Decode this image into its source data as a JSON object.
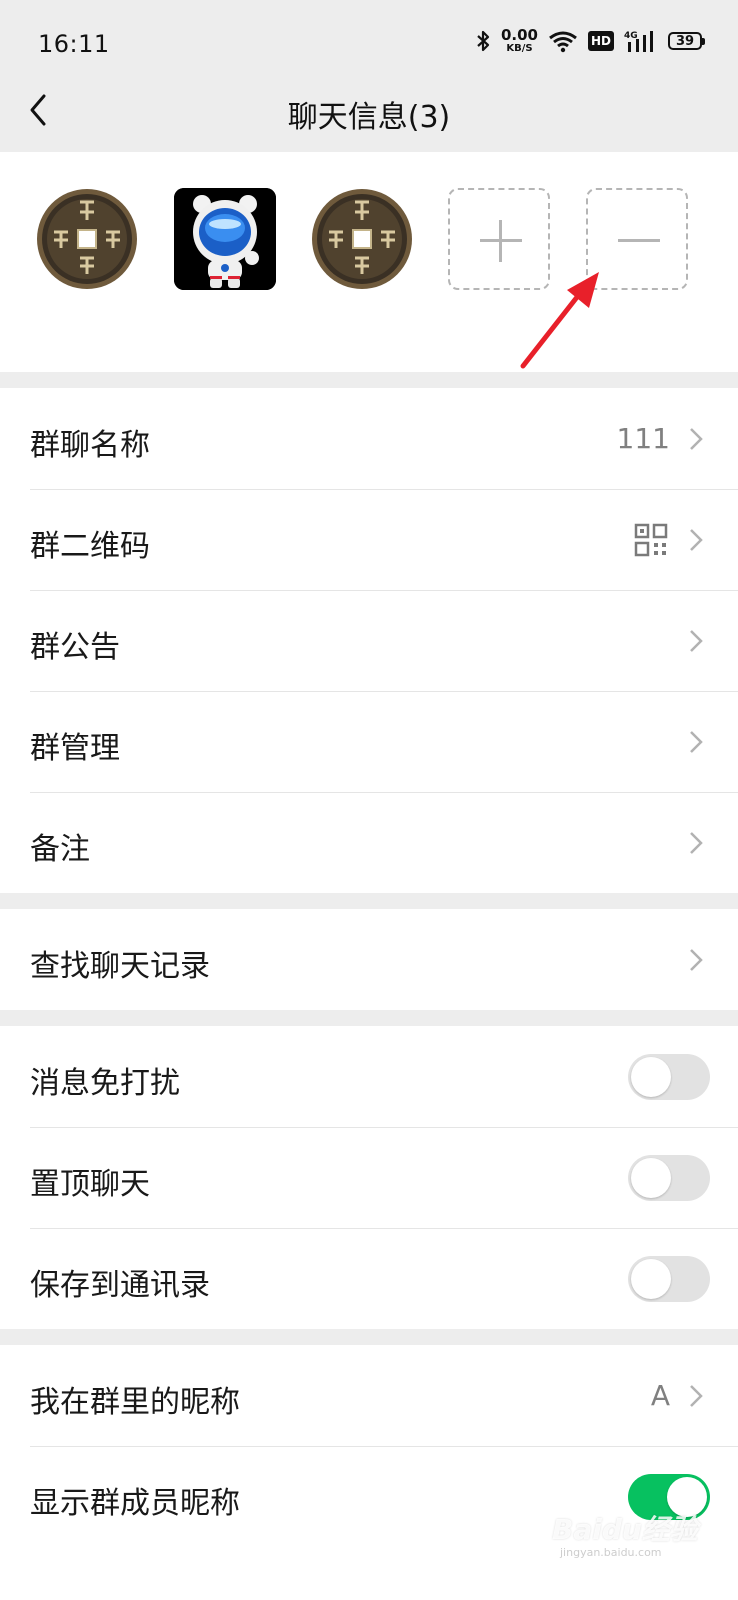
{
  "status_bar": {
    "time": "16:11",
    "net_speed_value": "0.00",
    "net_speed_unit": "KB/S",
    "hd_label": "HD",
    "network_type": "4G",
    "battery": "39"
  },
  "nav": {
    "title": "聊天信息(3)"
  },
  "members": {
    "icons": [
      "coin-avatar",
      "astronaut-avatar",
      "coin-avatar",
      "add-member-icon",
      "remove-member-icon"
    ]
  },
  "group1": {
    "items": [
      {
        "label": "群聊名称",
        "value": "111"
      },
      {
        "label": "群二维码"
      },
      {
        "label": "群公告"
      },
      {
        "label": "群管理"
      },
      {
        "label": "备注"
      }
    ]
  },
  "group2": {
    "items": [
      {
        "label": "查找聊天记录"
      }
    ]
  },
  "group3": {
    "items": [
      {
        "label": "消息免打扰",
        "toggle": false
      },
      {
        "label": "置顶聊天",
        "toggle": false
      },
      {
        "label": "保存到通讯录",
        "toggle": false
      }
    ]
  },
  "group4": {
    "items": [
      {
        "label": "我在群里的昵称",
        "value": "A"
      },
      {
        "label": "显示群成员昵称",
        "toggle": true
      }
    ]
  },
  "colors": {
    "background": "#ededed",
    "toggle_on": "#07c160",
    "arrow": "#e8202a"
  },
  "watermark": {
    "brand": "Baidu经验",
    "url": "jingyan.baidu.com"
  }
}
